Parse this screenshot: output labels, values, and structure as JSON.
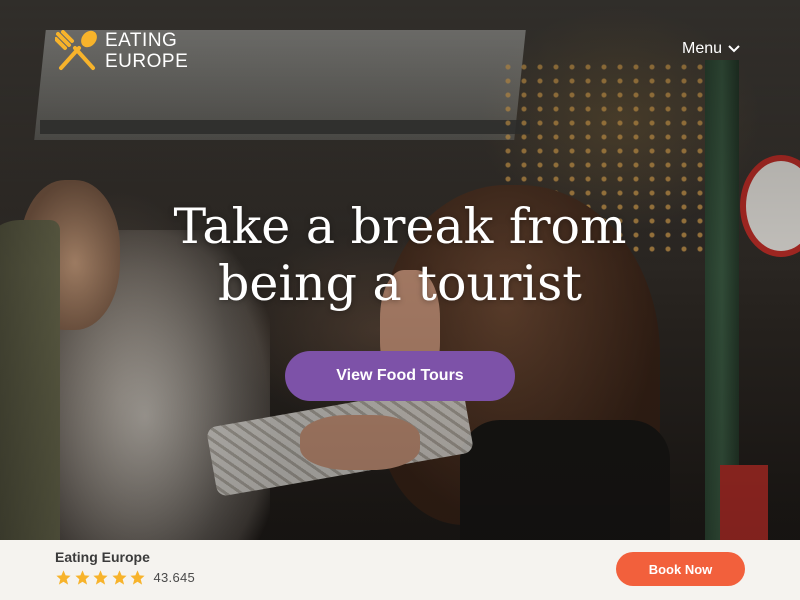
{
  "brand": {
    "logo_line1": "EATING",
    "logo_line2": "EUROPE",
    "logo_icon": "fork-spoon-icon",
    "accent_color": "#f7b32b"
  },
  "nav": {
    "menu_label": "Menu",
    "menu_icon": "chevron-down-icon"
  },
  "hero": {
    "headline_line1": "Take a break from",
    "headline_line2": "being a tourist",
    "cta_label": "View Food Tours",
    "cta_color": "#7d52a8"
  },
  "bottom_bar": {
    "brand_name": "Eating Europe",
    "stars": 5,
    "star_color": "#f7b32b",
    "rating_count": "43.645",
    "book_label": "Book Now",
    "book_color": "#f2603c"
  }
}
